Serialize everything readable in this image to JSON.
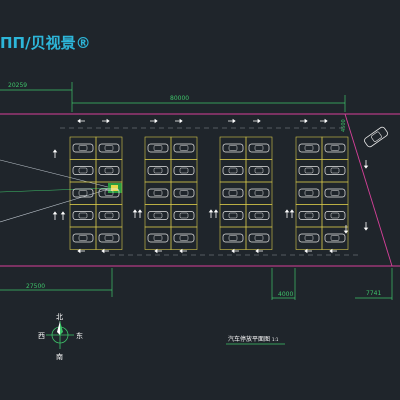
{
  "watermark": {
    "text": "ΠΠ/贝视景®"
  },
  "dimensions": {
    "top_left": "20259",
    "top_total": "80000",
    "right_vertical": "4500",
    "bottom_left": "27500",
    "bottom_mid": "4000",
    "bottom_right": "7741"
  },
  "compass": {
    "north": "北",
    "south": "南",
    "east": "东",
    "west": "西"
  },
  "plan_title": {
    "main": "汽车停放平面图",
    "scale": "1:1"
  },
  "colors": {
    "background": "#1f252b",
    "boundary": "#d7409a",
    "dimension": "#3ec46a",
    "stall": "#d8c84a",
    "car": "#e6e6e6",
    "arrow": "#ffffff",
    "centerline": "#8a8f96",
    "watermark": "#2db6d9",
    "wedge": "#bfc7cf"
  },
  "layout": {
    "stall_blocks": 4,
    "rows_per_block": 5,
    "stalls_per_row": 2
  }
}
